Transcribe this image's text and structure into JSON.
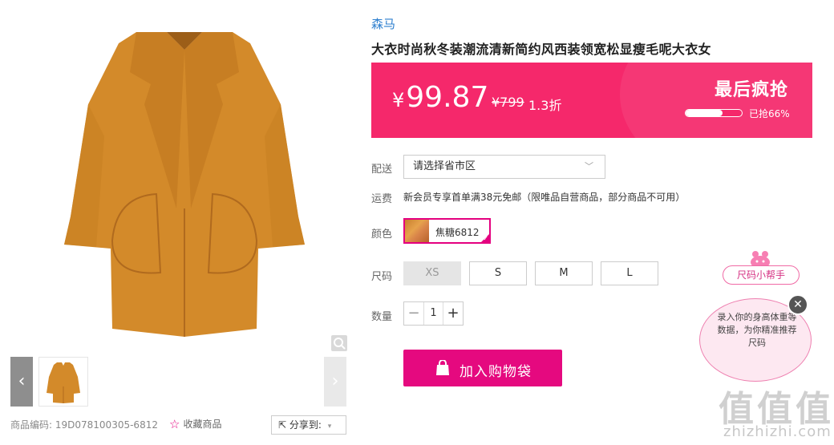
{
  "gallery": {
    "main_image": "orange-wool-coat",
    "thumbnails": [
      "orange-wool-coat"
    ],
    "prev_icon": "chevron-left-icon",
    "next_icon": "chevron-right-icon",
    "zoom_icon": "magnifier-icon"
  },
  "product": {
    "brand": "森马",
    "title": "大衣时尚秋冬装潮流清新简约风西装领宽松显瘦毛呢大衣女",
    "code_label": "商品编码:",
    "code": "19D078100305-6812",
    "favorite_label": "收藏商品",
    "share_label": "分享到:"
  },
  "price": {
    "currency": "¥",
    "current": "99.87",
    "original": "¥799",
    "discount": "1.3折",
    "flash_title": "最后疯抢",
    "sold_text": "已抢66%",
    "sold_percent": 66,
    "banner_color": "#f5286b"
  },
  "delivery": {
    "label": "配送",
    "placeholder": "请选择省市区"
  },
  "shipping": {
    "label": "运费",
    "text": "新会员专享首单满38元免邮（限唯品自营商品，部分商品不可用）"
  },
  "color": {
    "label": "颜色",
    "selected": "焦糖6812"
  },
  "size": {
    "label": "尺码",
    "options": [
      "XS",
      "S",
      "M",
      "L"
    ],
    "disabled": [
      "XS"
    ]
  },
  "quantity": {
    "label": "数量",
    "value": "1",
    "minus": "−",
    "plus": "+"
  },
  "cart": {
    "label": "加入购物袋",
    "color": "#e5097f"
  },
  "size_helper": {
    "title": "尺码小帮手",
    "bubble_text": "录入你的身高体重等数据，为你精准推荐尺码",
    "close": "✕"
  },
  "watermark": {
    "logo": "值值值",
    "url": "zhizhizhi.com"
  }
}
